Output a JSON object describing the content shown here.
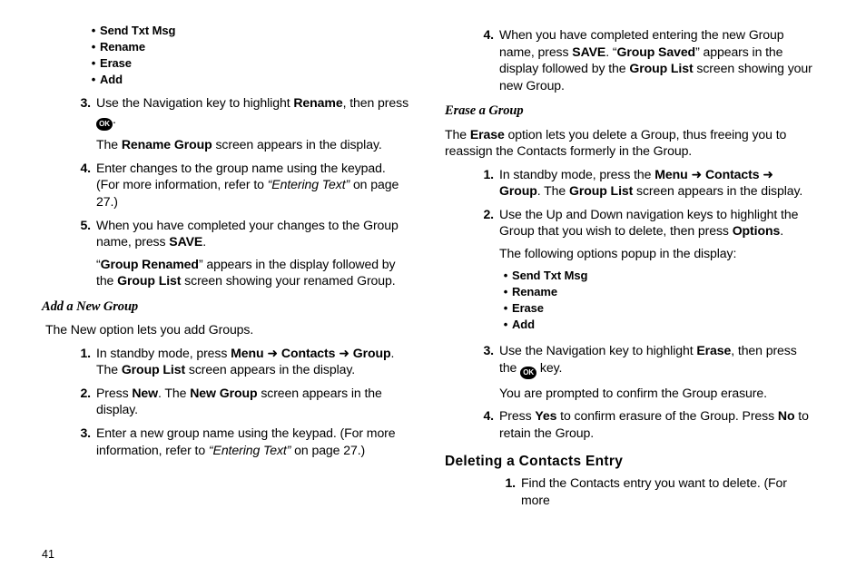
{
  "left": {
    "top_bullets": [
      "Send Txt Msg",
      "Rename",
      "Erase",
      "Add"
    ],
    "rename_steps": {
      "s3": {
        "num": "3.",
        "p1a": "Use the Navigation key to highlight ",
        "p1b": "Rename",
        "p1c": ", then press ",
        "p1d": ".",
        "p2a": "The ",
        "p2b": "Rename Group",
        "p2c": " screen appears in the display."
      },
      "s4": {
        "num": "4.",
        "p1a": "Enter changes to the group name using the keypad. (For more information, refer to ",
        "p1ref": "“Entering Text”",
        "p1b": "  on page 27.)"
      },
      "s5": {
        "num": "5.",
        "p1a": "When you have completed your changes to the Group name, press ",
        "p1b": "SAVE",
        "p1c": ".",
        "p2a": "“",
        "p2b": "Group Renamed",
        "p2c": "” appears in the display followed by the ",
        "p2d": "Group List",
        "p2e": " screen showing your renamed Group."
      }
    },
    "add_heading": "Add a New Group",
    "add_lead": "The New option lets you add Groups.",
    "add_steps": {
      "s1": {
        "num": "1.",
        "p1a": "In standby mode, press ",
        "menu": "Menu",
        "arrow1": " ➜ ",
        "contacts": "Contacts",
        "arrow2": " ➜ ",
        "group": "Group",
        "p1b": ". The ",
        "p1c": "Group List",
        "p1d": " screen appears in the display."
      },
      "s2": {
        "num": "2.",
        "p1a": "Press ",
        "p1b": "New",
        "p1c": ". The ",
        "p1d": "New Group",
        "p1e": " screen appears in the display."
      },
      "s3": {
        "num": "3.",
        "p1a": "Enter a new group name using the keypad. (For more information, refer to ",
        "p1ref": "“Entering Text”",
        "p1b": "  on page 27.)"
      }
    }
  },
  "right": {
    "cont_step4": {
      "num": "4.",
      "p1a": "When you have completed entering the new Group name, press ",
      "p1b": "SAVE",
      "p1c": ". “",
      "p1d": "Group Saved",
      "p1e": "” appears in the display followed by the ",
      "p1f": "Group List",
      "p1g": " screen showing your new Group."
    },
    "erase_heading": "Erase a Group",
    "erase_lead_a": "The ",
    "erase_lead_b": "Erase",
    "erase_lead_c": " option lets you delete a Group, thus freeing you to reassign the Contacts formerly in the Group.",
    "erase_steps": {
      "s1": {
        "num": "1.",
        "p1a": "In standby mode, press the ",
        "menu": "Menu",
        "arrow1": " ➜ ",
        "contacts": "Contacts",
        "arrow2": " ➜ ",
        "group": "Group",
        "p1b": ". The ",
        "p1c": "Group List",
        "p1d": " screen appears in the display."
      },
      "s2": {
        "num": "2.",
        "p1a": "Use the Up and Down navigation keys to highlight the Group that you wish to delete, then press ",
        "p1b": "Options",
        "p1c": ".",
        "p2": "The following options popup in the display:",
        "bullets": [
          "Send Txt Msg",
          "Rename",
          "Erase",
          "Add"
        ]
      },
      "s3": {
        "num": "3.",
        "p1a": "Use the Navigation key to highlight ",
        "p1b": "Erase",
        "p1c": ", then press the ",
        "p1d": " key.",
        "p2": "You are prompted to confirm the Group erasure."
      },
      "s4": {
        "num": "4.",
        "p1a": "Press ",
        "p1b": "Yes",
        "p1c": " to confirm erasure of the Group. Press ",
        "p1d": "No",
        "p1e": " to retain the Group."
      }
    },
    "del_heading": "Deleting a Contacts Entry",
    "del_step1": {
      "num": "1.",
      "p1": "Find the Contacts entry you want to delete. (For more"
    }
  },
  "page_number": "41",
  "ok_label": "OK"
}
